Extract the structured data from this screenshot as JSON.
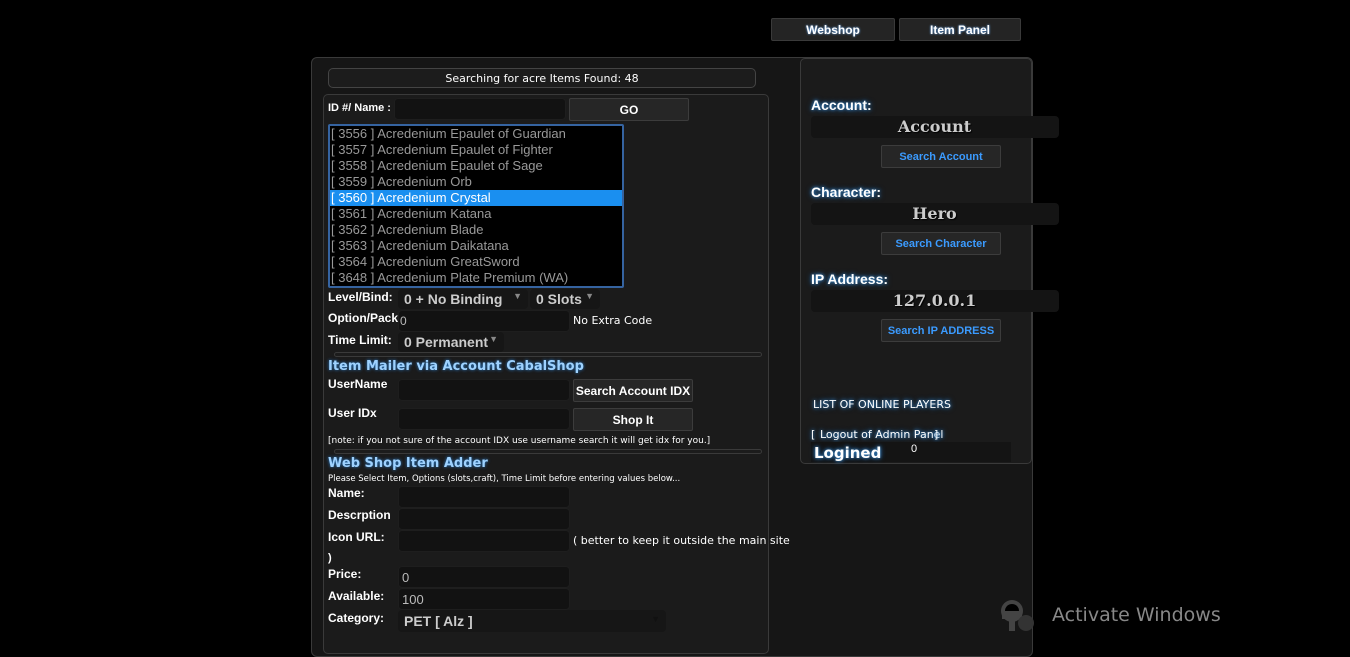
{
  "topnav": {
    "webshop": "Webshop",
    "item_panel": "Item Panel"
  },
  "status": "Searching for acre Items Found: 48",
  "search": {
    "label": "ID #/ Name :",
    "value": "",
    "go": "GO"
  },
  "items": [
    {
      "label": "[ 3556 ] Acredenium Epaulet of Guardian",
      "selected": false
    },
    {
      "label": "[ 3557 ] Acredenium Epaulet of Fighter",
      "selected": false
    },
    {
      "label": "[ 3558 ] Acredenium Epaulet of Sage",
      "selected": false
    },
    {
      "label": "[ 3559 ] Acredenium Orb",
      "selected": false
    },
    {
      "label": "[ 3560 ] Acredenium Crystal",
      "selected": true
    },
    {
      "label": "[ 3561 ] Acredenium Katana",
      "selected": false
    },
    {
      "label": "[ 3562 ] Acredenium Blade",
      "selected": false
    },
    {
      "label": "[ 3563 ] Acredenium Daikatana",
      "selected": false
    },
    {
      "label": "[ 3564 ] Acredenium GreatSword",
      "selected": false
    },
    {
      "label": "[ 3648 ] Acredenium Plate Premium (WA)",
      "selected": false
    }
  ],
  "options": {
    "level_bind_label": "Level/Bind:",
    "level_bind_value": "0 + No Binding",
    "slots_value": "0 Slots",
    "option_pack_label": "Option/Pack:",
    "option_pack_value": "0",
    "option_note": "No Extra Code",
    "time_limit_label": "Time Limit:",
    "time_limit_value": "0 Permanent"
  },
  "mailer": {
    "title": "Item Mailer via Account CabalShop",
    "username_label": "UserName",
    "username_value": "",
    "search_idx": "Search Account IDX",
    "useridx_label": "User IDx",
    "useridx_value": "",
    "shop_it": "Shop It",
    "note": "[note: if you not sure of the account IDX use username search it will get idx for you.]"
  },
  "adder": {
    "title": "Web Shop Item Adder",
    "hint": "Please Select Item, Options (slots,craft), Time Limit before entering values below...",
    "name_label": "Name:",
    "name_value": "",
    "desc_label": "Descrption",
    "desc_value": "",
    "icon_label": "Icon URL:",
    "icon_value": "",
    "icon_note": "( better to keep it outside the main site",
    "icon_note_end": ")",
    "price_label": "Price:",
    "price_value": "0",
    "available_label": "Available:",
    "available_value": "100",
    "category_label": "Category:",
    "category_value": "PET [ Alz ]"
  },
  "side": {
    "account_label": "Account:",
    "account_value": "Account",
    "search_account": "Search Account",
    "character_label": "Character:",
    "character_value": "Hero",
    "search_character": "Search Character",
    "ip_label": "IP Address:",
    "ip_value": "127.0.0.1",
    "search_ip": "Search IP ADDRESS",
    "online_players": "LIST OF ONLINE PLAYERS",
    "logout_open": "[",
    "logout": "Logout of Admin Panel",
    "logout_close": "]",
    "logined_label": "Logined",
    "logined_count": "0"
  },
  "watermark": "Activate Windows"
}
